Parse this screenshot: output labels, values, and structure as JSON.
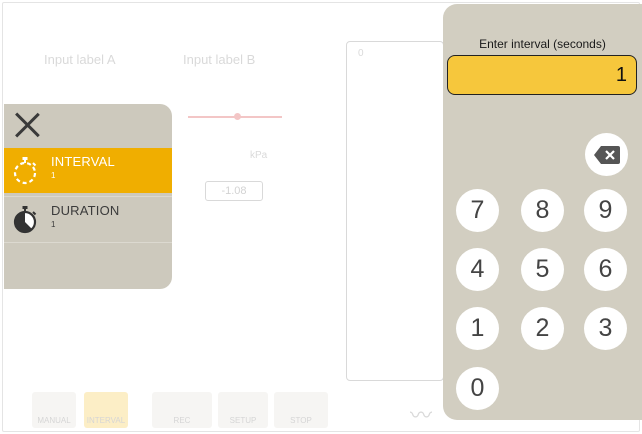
{
  "background": {
    "channel_a_label": "Input label A",
    "channel_b_label": "Input label B",
    "unit_label": "kPa",
    "value_box": "-1.08",
    "graph_tick": "0",
    "bottom_buttons": [
      "MANUAL",
      "INTERVAL",
      "REC",
      "SETUP",
      "STOP"
    ]
  },
  "menu": {
    "items": [
      {
        "title": "INTERVAL",
        "value": "1",
        "icon": "stopwatch-dashed-icon",
        "selected": true
      },
      {
        "title": "DURATION",
        "value": "1",
        "icon": "stopwatch-filled-icon",
        "selected": false
      }
    ]
  },
  "keypad": {
    "title": "Enter interval (seconds)",
    "value": "1",
    "keys": [
      "7",
      "8",
      "9",
      "4",
      "5",
      "6",
      "1",
      "2",
      "3",
      "0"
    ]
  },
  "colors": {
    "accent": "#f0ae00",
    "field": "#f6c73c",
    "panel": "#d2cec1",
    "menu_panel": "#cdc9bd"
  }
}
